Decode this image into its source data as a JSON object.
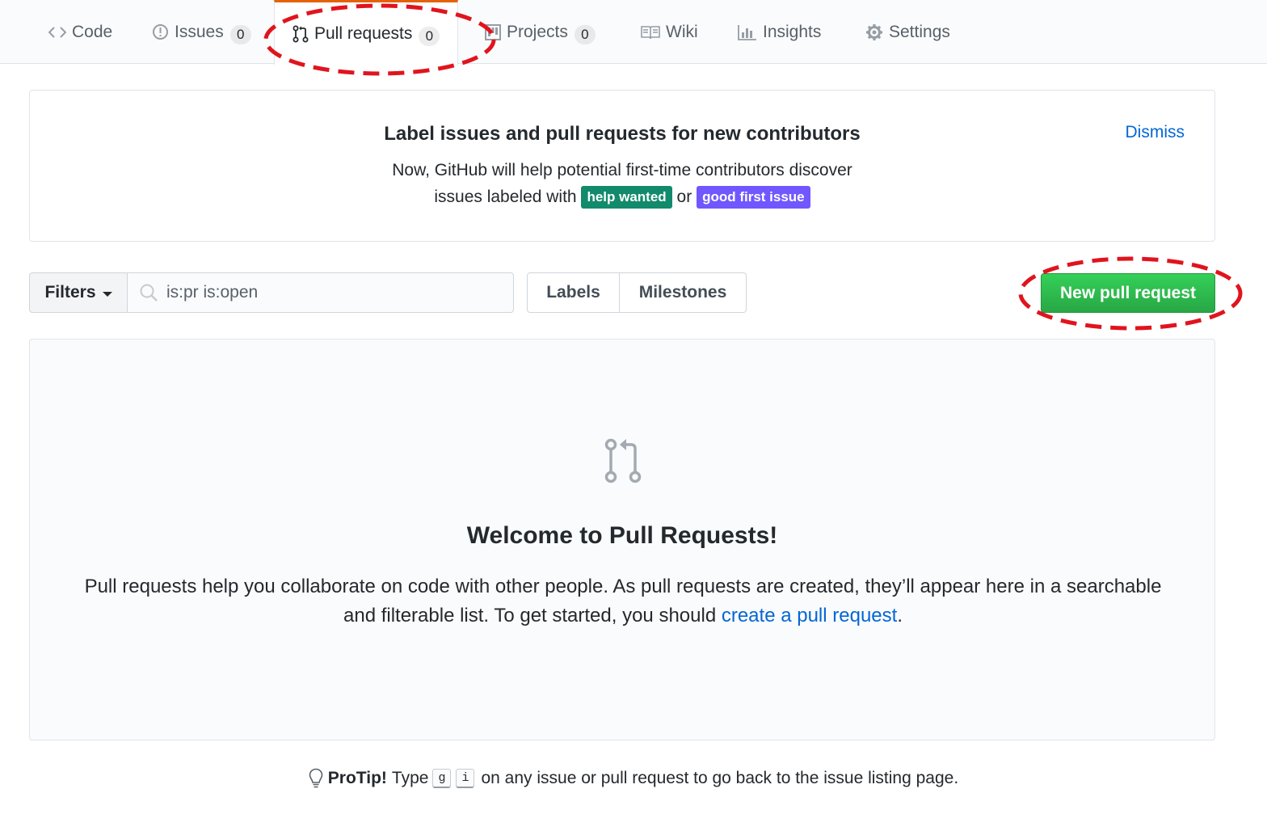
{
  "repo_nav": {
    "code": "Code",
    "issues": "Issues",
    "issues_count": "0",
    "pull_requests": "Pull requests",
    "pull_requests_count": "0",
    "projects": "Projects",
    "projects_count": "0",
    "wiki": "Wiki",
    "insights": "Insights",
    "settings": "Settings",
    "selected": "Pull requests",
    "accent_color": "#e36209"
  },
  "banner": {
    "title": "Label issues and pull requests for new contributors",
    "line1": "Now, GitHub will help potential first-time contributors discover",
    "line2_prefix": "issues labeled with",
    "label_help_wanted": "help wanted",
    "label_help_wanted_color": "#128a6c",
    "connector": "or",
    "label_good_first_issue": "good first issue",
    "label_good_first_issue_color": "#7057ff",
    "dismiss": "Dismiss"
  },
  "subnav": {
    "filters": "Filters",
    "search_value": "is:pr is:open",
    "labels": "Labels",
    "milestones": "Milestones",
    "new_pull_request": "New pull request"
  },
  "blankslate": {
    "title": "Welcome to Pull Requests!",
    "text_before_link": "Pull requests help you collaborate on code with other people. As pull requests are created, they’ll appear here in a searchable and filterable list. To get started, you should ",
    "link": "create a pull request",
    "text_after_link": "."
  },
  "protip": {
    "strong": "ProTip!",
    "type": "Type",
    "key1": "g",
    "key2": "i",
    "rest": "on any issue or pull request to go back to the issue listing page."
  },
  "annotations": {
    "color": "#e0141e",
    "targets": [
      "Pull requests",
      "New pull request"
    ]
  }
}
